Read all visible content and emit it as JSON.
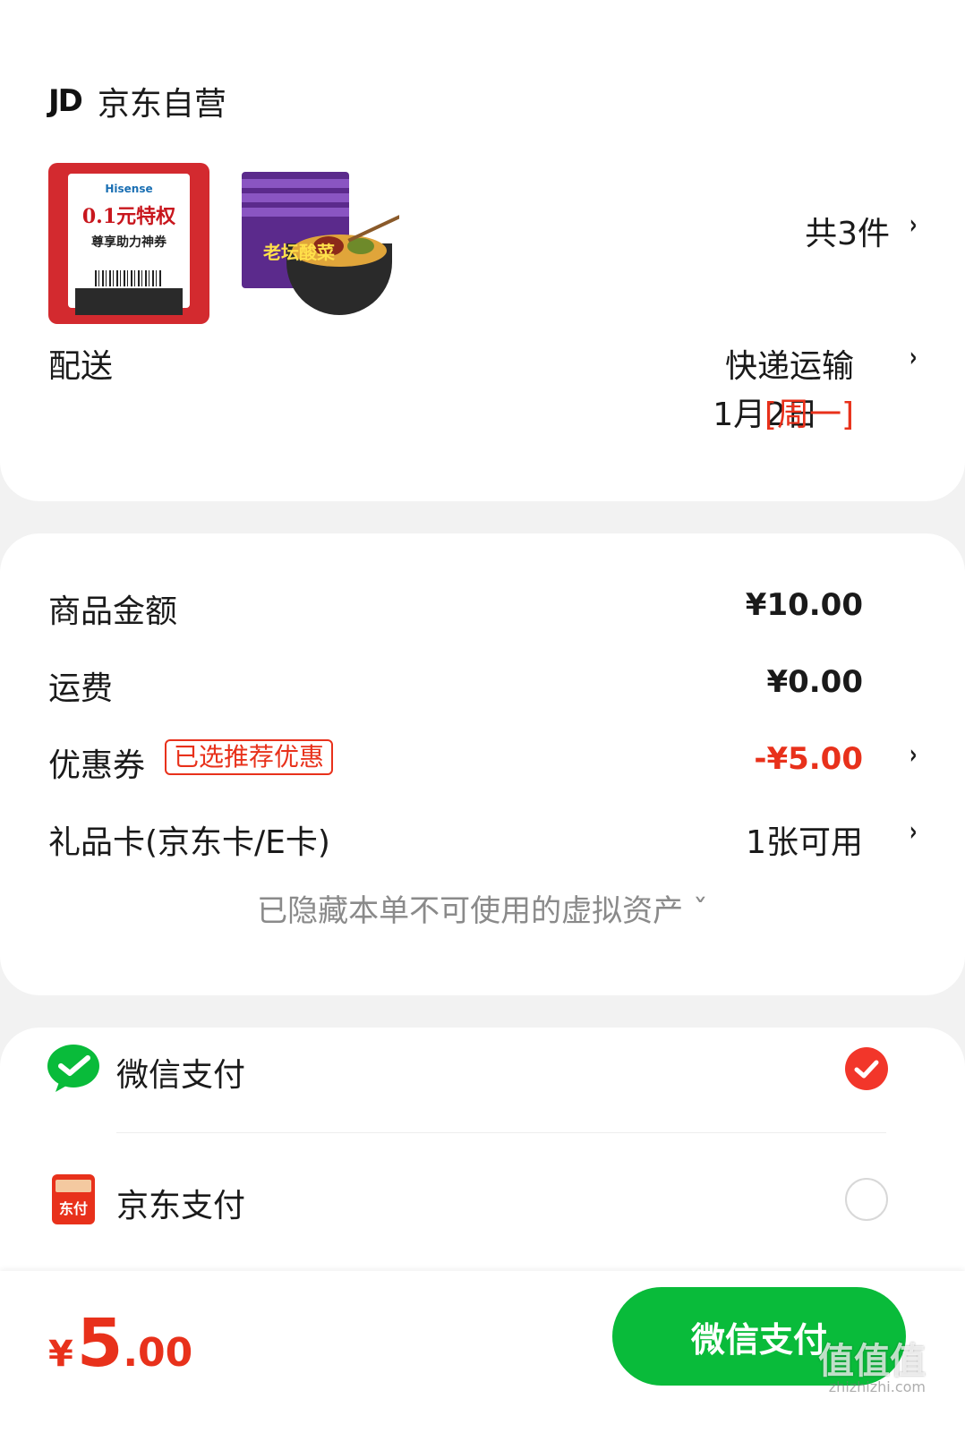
{
  "shop": {
    "logo_text": "JD",
    "name": "京东自营"
  },
  "products": {
    "item1": {
      "brand": "Hisense",
      "title": "0.1元特权",
      "subtitle": "尊享助力神券"
    },
    "item2": {
      "label": "老坛酸菜"
    },
    "count_label": "共3件"
  },
  "delivery": {
    "label": "配送",
    "method": "快递运输",
    "date": "1月2日",
    "weekday": "[周一]"
  },
  "amounts": {
    "goods_label": "商品金额",
    "goods_value": "¥10.00",
    "shipping_label": "运费",
    "shipping_value": "¥0.00",
    "coupon_label": "优惠券",
    "coupon_tag": "已选推荐优惠",
    "coupon_value": "-¥5.00",
    "giftcard_label": "礼品卡(京东卡/E卡)",
    "giftcard_value": "1张可用",
    "hidden_note": "已隐藏本单不可使用的虚拟资产 ˇ"
  },
  "payment": {
    "options": [
      {
        "label": "微信支付",
        "selected": true
      },
      {
        "label": "京东支付",
        "selected": false
      }
    ],
    "jd_pay_icon_text": "东付"
  },
  "bottom": {
    "currency": "¥",
    "total_int": "5",
    "total_dec": ".00",
    "pay_button": "微信支付"
  },
  "watermark": {
    "text": "值值值",
    "url": "zhizhizhi.com"
  },
  "colors": {
    "accent_red": "#e8311b",
    "wechat_green": "#09bb3a"
  }
}
